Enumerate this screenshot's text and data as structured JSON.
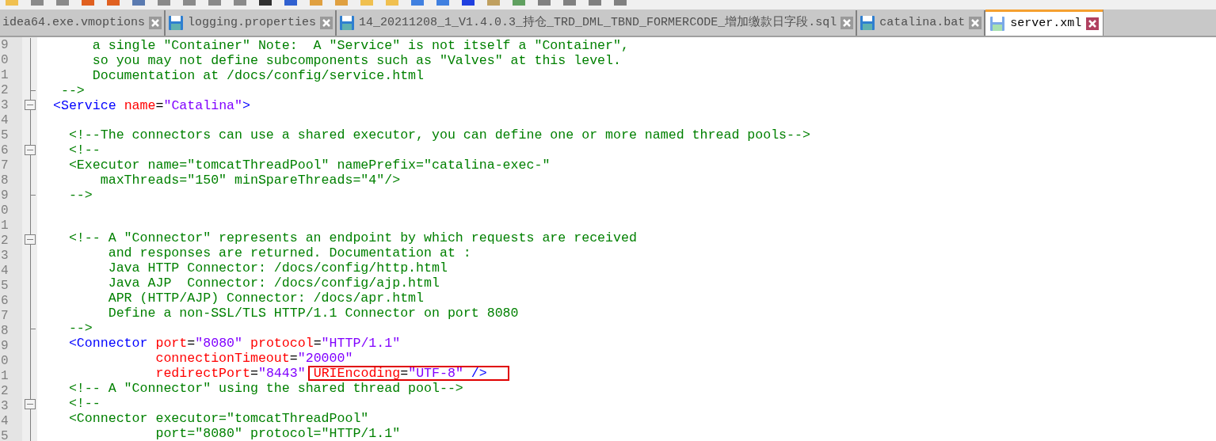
{
  "tabs": [
    {
      "label": "idea64.exe.vmoptions",
      "icon": false,
      "selected": false
    },
    {
      "label": "logging.properties",
      "icon": true,
      "selected": false
    },
    {
      "label": "14_20211208_1_V1.4.0.3_持仓_TRD_DML_TBND_FORMERCODE_增加缴款日字段.sql",
      "icon": true,
      "selected": false
    },
    {
      "label": "catalina.bat",
      "icon": true,
      "selected": false
    },
    {
      "label": "server.xml",
      "icon": true,
      "selected": true
    }
  ],
  "lines": [
    {
      "number": "9",
      "kind": "body",
      "segments": [
        {
          "kind": "comment",
          "text": "     a single \"Container\" Note:  A \"Service\" is not itself a \"Container\","
        }
      ]
    },
    {
      "number": "0",
      "kind": "body",
      "segments": [
        {
          "kind": "comment",
          "text": "     so you may not define subcomponents such as \"Valves\" at this level."
        }
      ]
    },
    {
      "number": "1",
      "kind": "body",
      "segments": [
        {
          "kind": "comment",
          "text": "     Documentation at /docs/config/service.html"
        }
      ]
    },
    {
      "number": "2",
      "kind": "fold_end",
      "segments": [
        {
          "kind": "comment",
          "text": " -->"
        }
      ]
    },
    {
      "number": "3",
      "kind": "fold_start",
      "segments": [
        {
          "kind": "tag",
          "text": "<Service"
        },
        {
          "kind": "attr",
          "text": " name"
        },
        {
          "kind": "plain",
          "text": "="
        },
        {
          "kind": "value",
          "text": "\"Catalina\""
        },
        {
          "kind": "tag",
          "text": ">"
        }
      ]
    },
    {
      "number": "4",
      "kind": "body"
    },
    {
      "number": "5",
      "kind": "body",
      "segments": [
        {
          "kind": "comment",
          "text": "  <!--The connectors can use a shared executor, you can define one or more named thread pools-->"
        }
      ]
    },
    {
      "number": "6",
      "kind": "fold_start",
      "segments": [
        {
          "kind": "comment",
          "text": "  <!--"
        }
      ]
    },
    {
      "number": "7",
      "kind": "body",
      "segments": [
        {
          "kind": "comment",
          "text": "  <Executor name=\"tomcatThreadPool\" namePrefix=\"catalina-exec-\""
        }
      ]
    },
    {
      "number": "8",
      "kind": "body",
      "segments": [
        {
          "kind": "comment",
          "text": "      maxThreads=\"150\" minSpareThreads=\"4\"/>"
        }
      ]
    },
    {
      "number": "9",
      "kind": "fold_end",
      "segments": [
        {
          "kind": "comment",
          "text": "  -->"
        }
      ]
    },
    {
      "number": "0",
      "kind": "body"
    },
    {
      "number": "1",
      "kind": "body"
    },
    {
      "number": "2",
      "kind": "fold_start",
      "segments": [
        {
          "kind": "comment",
          "text": "  <!-- A \"Connector\" represents an endpoint by which requests are received"
        }
      ]
    },
    {
      "number": "3",
      "kind": "body",
      "segments": [
        {
          "kind": "comment",
          "text": "       and responses are returned. Documentation at :"
        }
      ]
    },
    {
      "number": "4",
      "kind": "body",
      "segments": [
        {
          "kind": "comment",
          "text": "       Java HTTP Connector: /docs/config/http.html"
        }
      ]
    },
    {
      "number": "5",
      "kind": "body",
      "segments": [
        {
          "kind": "comment",
          "text": "       Java AJP  Connector: /docs/config/ajp.html"
        }
      ]
    },
    {
      "number": "6",
      "kind": "body",
      "segments": [
        {
          "kind": "comment",
          "text": "       APR (HTTP/AJP) Connector: /docs/apr.html"
        }
      ]
    },
    {
      "number": "7",
      "kind": "body",
      "segments": [
        {
          "kind": "comment",
          "text": "       Define a non-SSL/TLS HTTP/1.1 Connector on port 8080"
        }
      ]
    },
    {
      "number": "8",
      "kind": "fold_end",
      "segments": [
        {
          "kind": "comment",
          "text": "  -->"
        }
      ]
    },
    {
      "number": "9",
      "kind": "body",
      "segments": [
        {
          "kind": "tag",
          "text": "  <Connector"
        },
        {
          "kind": "attr",
          "text": " port"
        },
        {
          "kind": "plain",
          "text": "="
        },
        {
          "kind": "value",
          "text": "\"8080\""
        },
        {
          "kind": "attr",
          "text": " protocol"
        },
        {
          "kind": "plain",
          "text": "="
        },
        {
          "kind": "value",
          "text": "\"HTTP/1.1\""
        }
      ]
    },
    {
      "number": "0",
      "kind": "body",
      "segments": [
        {
          "kind": "attr",
          "text": "             connectionTimeout"
        },
        {
          "kind": "plain",
          "text": "="
        },
        {
          "kind": "value",
          "text": "\"20000\""
        }
      ]
    },
    {
      "number": "1",
      "kind": "body",
      "segments": [
        {
          "kind": "attr",
          "text": "             redirectPort"
        },
        {
          "kind": "plain",
          "text": "="
        },
        {
          "kind": "value",
          "text": "\"8443\""
        }
      ],
      "highlight": [
        {
          "kind": "attr",
          "text": "URIEncoding"
        },
        {
          "kind": "plain",
          "text": "="
        },
        {
          "kind": "value",
          "text": "\"UTF-8\""
        },
        {
          "kind": "tag",
          "text": " />"
        }
      ]
    },
    {
      "number": "2",
      "kind": "body",
      "segments": [
        {
          "kind": "comment",
          "text": "  <!-- A \"Connector\" using the shared thread pool-->"
        }
      ]
    },
    {
      "number": "3",
      "kind": "fold_start",
      "segments": [
        {
          "kind": "comment",
          "text": "  <!--"
        }
      ]
    },
    {
      "number": "4",
      "kind": "body",
      "segments": [
        {
          "kind": "comment",
          "text": "  <Connector executor=\"tomcatThreadPool\""
        }
      ]
    },
    {
      "number": "5",
      "kind": "body",
      "segments": [
        {
          "kind": "comment",
          "text": "             port=\"8080\" protocol=\"HTTP/1.1\""
        }
      ]
    }
  ]
}
